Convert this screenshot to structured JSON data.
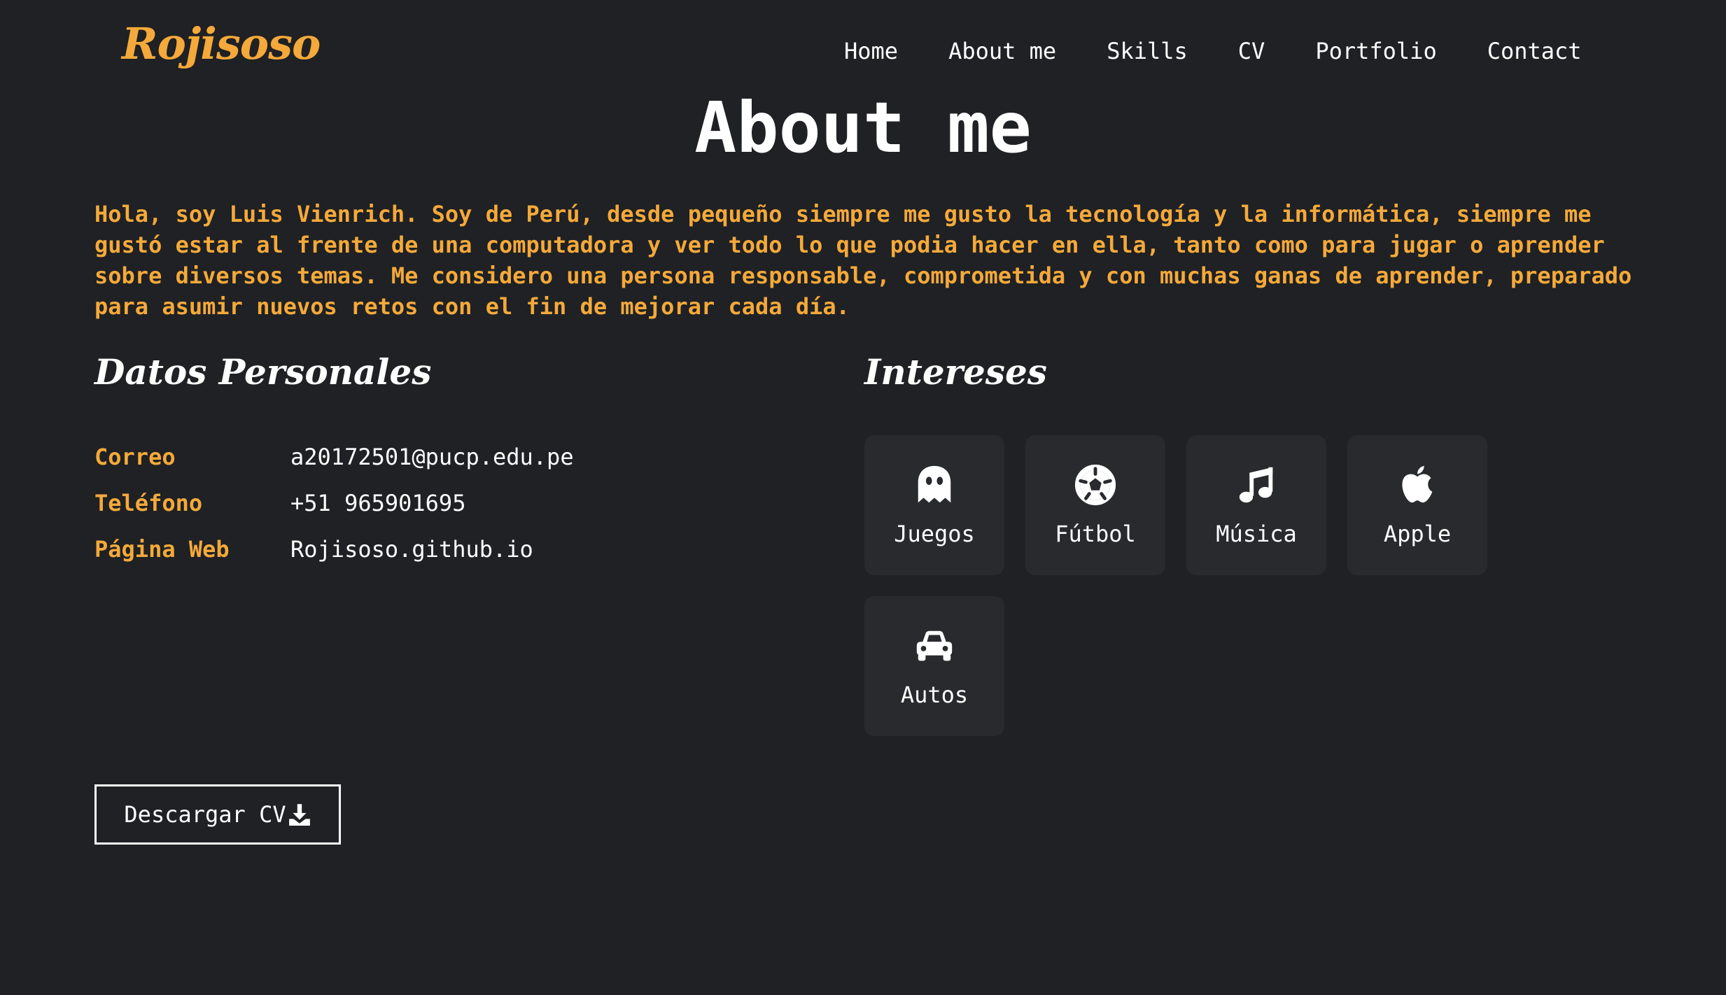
{
  "brand": {
    "logo_text": "Rojisoso",
    "accent_color": "#f4a93a",
    "background_color": "#1f2124",
    "card_color": "#282a2e"
  },
  "nav": {
    "items": [
      {
        "label": "Home"
      },
      {
        "label": "About me"
      },
      {
        "label": "Skills"
      },
      {
        "label": "CV"
      },
      {
        "label": "Portfolio"
      },
      {
        "label": "Contact"
      }
    ]
  },
  "main": {
    "title": "About me",
    "intro": "Hola, soy Luis Vienrich. Soy de Perú, desde pequeño siempre me gusto la tecnología y la informática, siempre me gustó estar al frente de una computadora y ver todo lo que podia hacer en ella, tanto como para jugar o aprender sobre diversos temas. Me considero una persona responsable, comprometida y con muchas ganas de aprender, preparado para asumir nuevos retos con el fin de mejorar cada día."
  },
  "personal": {
    "heading": "Datos Personales",
    "rows": [
      {
        "label": "Correo",
        "value": "a20172501@pucp.edu.pe"
      },
      {
        "label": "Teléfono",
        "value": "+51 965901695"
      },
      {
        "label": "Página Web",
        "value": "Rojisoso.github.io"
      }
    ]
  },
  "interests": {
    "heading": "Intereses",
    "items": [
      {
        "label": "Juegos",
        "icon": "ghost-icon"
      },
      {
        "label": "Fútbol",
        "icon": "soccer-ball-icon"
      },
      {
        "label": "Música",
        "icon": "music-note-icon"
      },
      {
        "label": "Apple",
        "icon": "apple-icon"
      },
      {
        "label": "Autos",
        "icon": "car-icon"
      }
    ]
  },
  "download": {
    "label": "Descargar CV",
    "icon": "download-icon"
  }
}
